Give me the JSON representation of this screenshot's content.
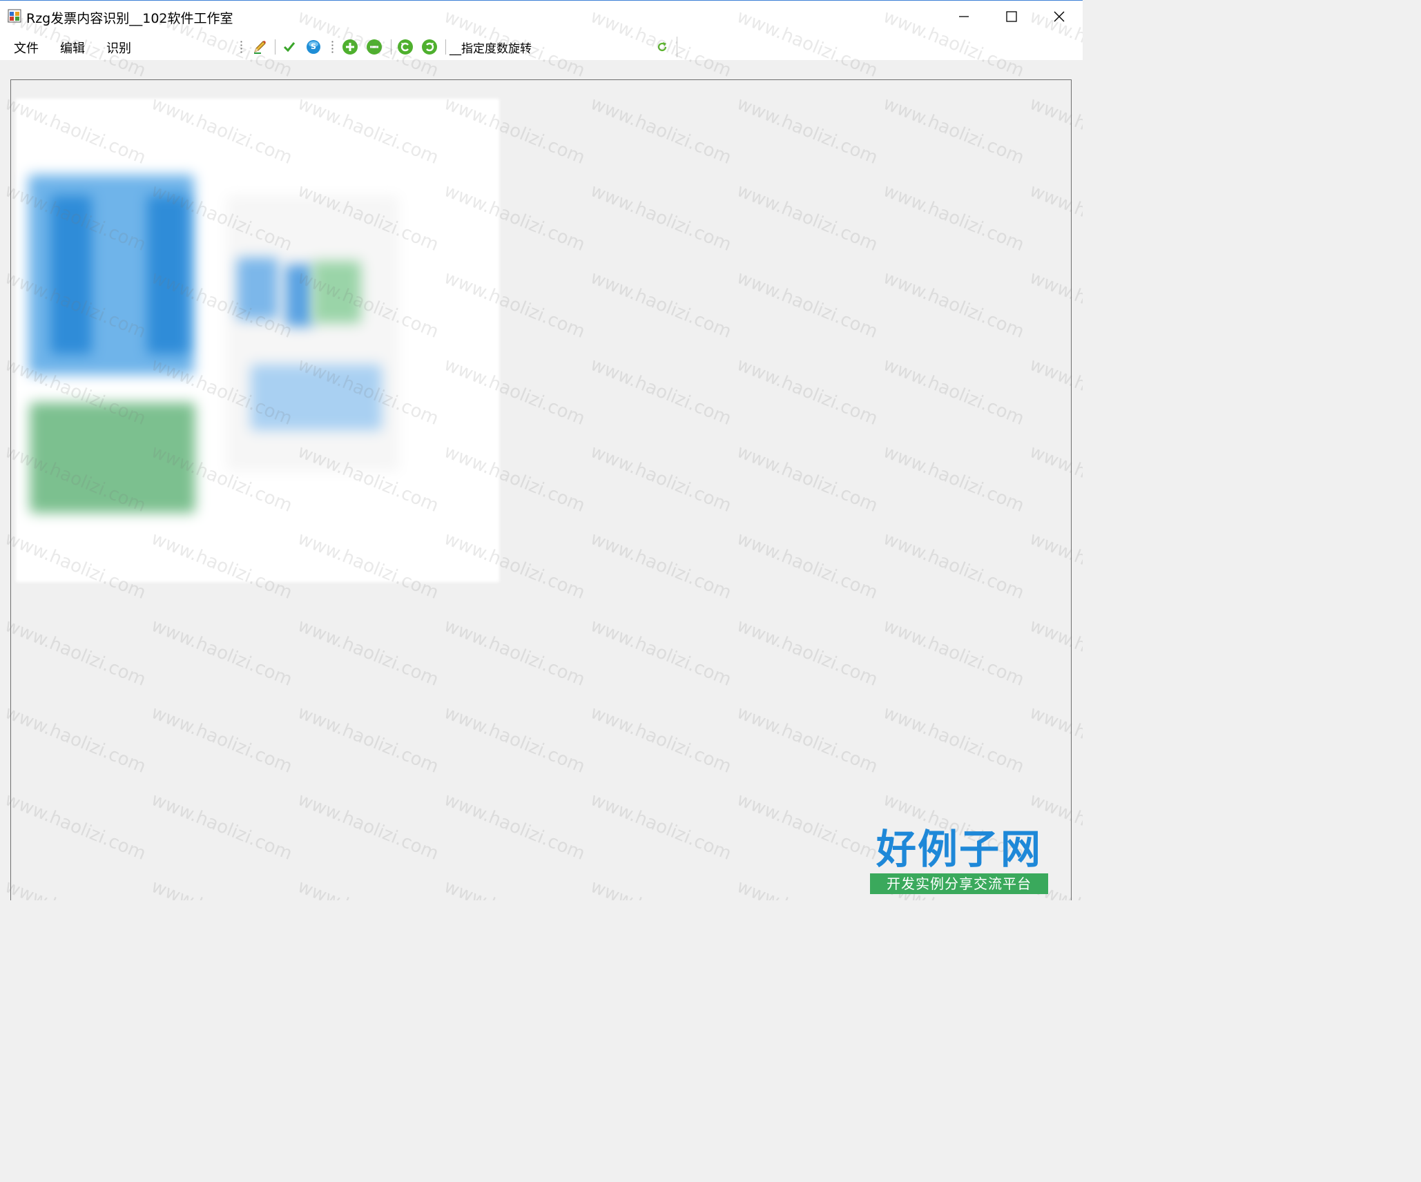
{
  "window": {
    "title": "Rzg发票内容识别__102软件工作室",
    "controls": {
      "minimize": "minimize-icon",
      "maximize": "maximize-icon",
      "close": "close-icon"
    }
  },
  "menu": {
    "items": [
      {
        "label": "文件"
      },
      {
        "label": "编辑"
      },
      {
        "label": "识别"
      }
    ]
  },
  "toolbar": {
    "buttons": [
      {
        "icon": "pencil-icon"
      },
      {
        "icon": "checkmark-icon"
      },
      {
        "icon": "scan-icon"
      },
      {
        "icon": "zoom-in-icon"
      },
      {
        "icon": "zoom-out-icon"
      },
      {
        "icon": "rotate-left-icon"
      },
      {
        "icon": "rotate-right-icon"
      }
    ],
    "rotate_label": "__指定度数旋转",
    "rotate_value": "",
    "apply_icon": "refresh-icon"
  },
  "watermark": {
    "text": "www.haolizi.com"
  },
  "site_logo": {
    "main": "好例子网",
    "sub": "开发实例分享交流平台"
  },
  "colors": {
    "title_accent": "#3c7fd6",
    "toolbar_green": "#5cb52e",
    "logo_blue": "#1e88d8",
    "logo_green": "#3aa95c"
  }
}
